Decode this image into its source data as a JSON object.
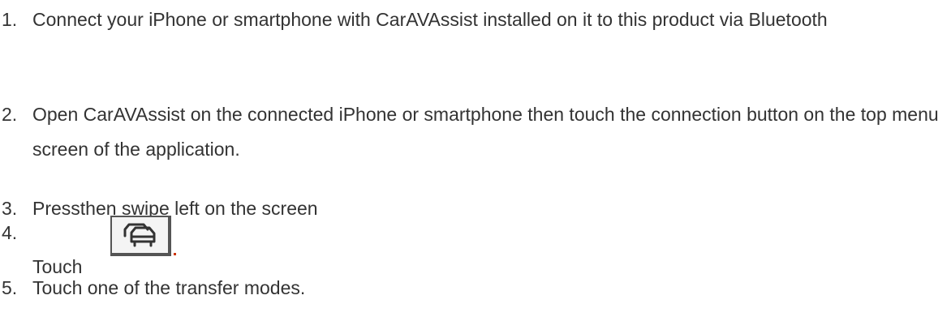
{
  "steps": [
    {
      "num": "1.",
      "text": "Connect your iPhone or smartphone with CarAVAssist installed on it to this product via Bluetooth"
    },
    {
      "num": "2.",
      "text": "Open CarAVAssist on the connected iPhone or smartphone then touch the connection button on the top menu screen of the application."
    },
    {
      "num": "3.",
      "text": "Pressthen swipe left on the screen"
    },
    {
      "num": "4.",
      "text": "Touch",
      "icon": "car-transfer-icon"
    },
    {
      "num": "5.",
      "text": "Touch one of the transfer modes."
    }
  ],
  "colors": {
    "text": "#333333",
    "icon_border": "#555555",
    "accent_dot": "#cc3300"
  }
}
